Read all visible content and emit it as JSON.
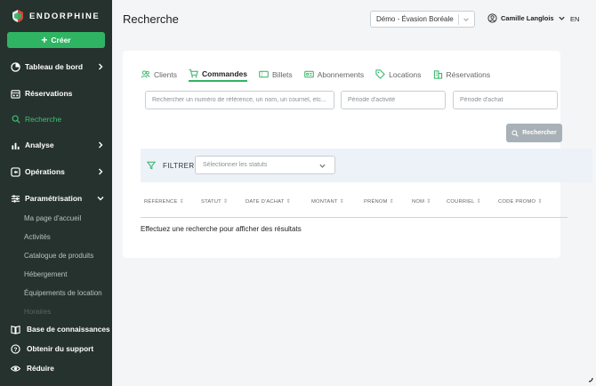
{
  "brand": {
    "name": "ENDORPHINE",
    "accent": "#2fb463",
    "sidebar_bg": "#26322d"
  },
  "sidebar": {
    "create_label": "Créer",
    "items": [
      {
        "label": "Tableau de bord",
        "icon": "dashboard-icon",
        "expandable": true
      },
      {
        "label": "Réservations",
        "icon": "calendar-icon",
        "expandable": false
      },
      {
        "label": "Recherche",
        "icon": "search-icon",
        "expandable": false,
        "active": true
      },
      {
        "label": "Analyse",
        "icon": "bar-chart-icon",
        "expandable": true
      },
      {
        "label": "Opérations",
        "icon": "operations-icon",
        "expandable": true
      },
      {
        "label": "Paramétrisation",
        "icon": "sliders-icon",
        "expandable": true,
        "expanded": true
      }
    ],
    "sub_items": [
      "Ma page d'accueil",
      "Activités",
      "Catalogue de produits",
      "Hébergement",
      "Équipements de location",
      "Horaires"
    ],
    "bottom": [
      {
        "label": "Base de connaissances",
        "icon": "book-icon"
      },
      {
        "label": "Obtenir du support",
        "icon": "help-icon"
      },
      {
        "label": "Réduire",
        "icon": "eye-icon"
      }
    ]
  },
  "header": {
    "title": "Recherche",
    "org_select": "Démo - Évasion Boréale",
    "user_name": "Camille Langlois",
    "lang": "EN"
  },
  "tabs": [
    {
      "label": "Clients",
      "icon": "users-icon",
      "active": false
    },
    {
      "label": "Commandes",
      "icon": "cart-icon",
      "active": true
    },
    {
      "label": "Billets",
      "icon": "ticket-icon",
      "active": false
    },
    {
      "label": "Abonnements",
      "icon": "card-icon",
      "active": false
    },
    {
      "label": "Locations",
      "icon": "tag-icon",
      "active": false
    },
    {
      "label": "Réservations",
      "icon": "building-icon",
      "active": false
    }
  ],
  "search": {
    "query_placeholder": "Rechercher un numéro de référence, un nom, un courriel, etc...",
    "activity_period_placeholder": "Période d'activité",
    "purchase_period_placeholder": "Période d'achat",
    "button_label": "Rechercher"
  },
  "filter": {
    "label": "FILTRER",
    "status_placeholder": "Sélectionner les statuts"
  },
  "table": {
    "columns": [
      "RÉFÉRENCE",
      "STATUT",
      "DATE D'ACHAT",
      "MONTANT",
      "PRÉNOM",
      "NOM",
      "COURRIEL",
      "CODE PROMO"
    ],
    "empty_message": "Effectuez une recherche pour afficher des résultats"
  }
}
